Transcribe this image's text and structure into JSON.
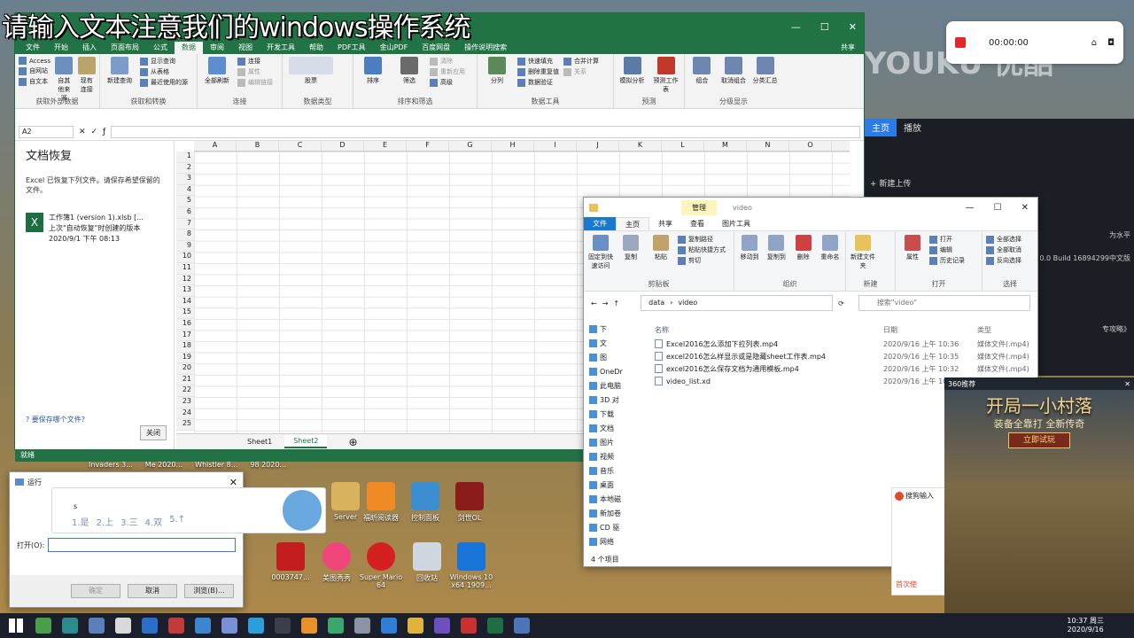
{
  "overlay": {
    "title": "请输入文本注意我们的windows操作系统"
  },
  "excel": {
    "tabs": [
      "文件",
      "开始",
      "插入",
      "页面布局",
      "公式",
      "数据",
      "审阅",
      "视图",
      "开发工具",
      "帮助",
      "PDF工具",
      "金山PDF",
      "百度网盘"
    ],
    "active_tab": "数据",
    "tell_me": "操作说明搜索",
    "share": "共享",
    "groups": [
      {
        "label": "获取外部数据",
        "buttons": [
          "Access",
          "自网站",
          "自文本",
          "自其他来源",
          "现有连接"
        ]
      },
      {
        "label": "获取和转换",
        "buttons": [
          "新建查询",
          "显示查询",
          "从表格",
          "最近使用的源"
        ]
      },
      {
        "label": "连接",
        "buttons": [
          "全部刷新",
          "连接",
          "属性",
          "编辑链接"
        ]
      },
      {
        "label": "数据类型",
        "buttons": [
          "股票"
        ]
      },
      {
        "label": "排序和筛选",
        "buttons": [
          "排序",
          "筛选",
          "清除",
          "重新应用",
          "高级"
        ]
      },
      {
        "label": "数据工具",
        "buttons": [
          "分列",
          "快速填充",
          "删除重复值",
          "数据验证",
          "合并计算",
          "关系"
        ]
      },
      {
        "label": "预测",
        "buttons": [
          "模拟分析",
          "预测工作表"
        ]
      },
      {
        "label": "分级显示",
        "buttons": [
          "组合",
          "取消组合",
          "分类汇总"
        ]
      }
    ],
    "name_box": "A2",
    "recovery": {
      "title": "文档恢复",
      "desc": "Excel 已恢复下列文件。请保存希望保留的文件。",
      "file_name": "工作簿1 (version 1).xlsb [...",
      "file_desc": "上次\"自动恢复\"时创建的版本",
      "file_time": "2020/9/1 下午 08:13",
      "question": "要保存哪个文件?",
      "close": "关闭"
    },
    "columns": [
      "A",
      "B",
      "C",
      "D",
      "E",
      "F",
      "G",
      "H",
      "I",
      "J",
      "K",
      "L",
      "M",
      "N",
      "O"
    ],
    "rows": [
      "1",
      "2",
      "3",
      "4",
      "5",
      "6",
      "7",
      "8",
      "9",
      "10",
      "11",
      "12",
      "13",
      "14",
      "15",
      "16",
      "17",
      "18",
      "19",
      "20",
      "21",
      "22",
      "23",
      "24",
      "25"
    ],
    "sheets": [
      "Sheet1",
      "Sheet2"
    ],
    "active_sheet": "Sheet2",
    "status": "就绪"
  },
  "explorer": {
    "manage": "管理",
    "folder_title": "video",
    "tabs": [
      "文件",
      "主页",
      "共享",
      "查看",
      "图片工具"
    ],
    "groups": [
      {
        "label": "剪贴板",
        "buttons": [
          "固定到快速访问",
          "复制",
          "粘贴",
          "复制路径",
          "粘贴快捷方式",
          "剪切"
        ]
      },
      {
        "label": "组织",
        "buttons": [
          "移动到",
          "复制到",
          "删除",
          "重命名"
        ]
      },
      {
        "label": "新建",
        "buttons": [
          "新建文件夹"
        ]
      },
      {
        "label": "打开",
        "buttons": [
          "属性",
          "打开",
          "编辑",
          "历史记录"
        ]
      },
      {
        "label": "选择",
        "buttons": [
          "全部选择",
          "全部取消",
          "反向选择"
        ]
      }
    ],
    "path": [
      "data",
      "video"
    ],
    "search_placeholder": "搜索\"video\"",
    "headers": [
      "名称",
      "日期",
      "类型"
    ],
    "files": [
      {
        "name": "Excel2016怎么添加下拉列表.mp4",
        "date": "2020/9/16 上午 10:36",
        "type": "媒体文件(.mp4)"
      },
      {
        "name": "excel2016怎么样显示或是隐藏sheet工作表.mp4",
        "date": "2020/9/16 上午 10:35",
        "type": "媒体文件(.mp4)"
      },
      {
        "name": "excel2016怎么保存文档为通用模板.mp4",
        "date": "2020/9/16 上午 10:32",
        "type": "媒体文件(.mp4)"
      },
      {
        "name": "video_list.xd",
        "date": "2020/9/16 上午 10:..",
        "type": ""
      }
    ],
    "nav": [
      "下",
      "文",
      "图",
      "OneDr",
      "此电脑",
      "3D 对",
      "下载",
      "文档",
      "图片",
      "视频",
      "音乐",
      "桌面",
      "本地磁",
      "新加卷",
      "CD 驱",
      "网络"
    ],
    "count": "4 个项目"
  },
  "recorder": {
    "time": "00:00:00"
  },
  "youku": {
    "tabs": [
      "主页",
      "播放"
    ],
    "new_upload": "+ 新建上传",
    "side_texts": [
      "为水平",
      "0.0 Build 16894299中文版",
      "专攻略》"
    ]
  },
  "ad": {
    "header": "360推荐",
    "title": "开局一小村落",
    "sub": "装备全靠打 全新传奇",
    "cta": "立即试玩"
  },
  "run": {
    "title": "运行",
    "open_label": "打开(O):",
    "ok": "确定",
    "cancel": "取消",
    "browse": "浏览(B)..."
  },
  "ime": {
    "code": "s",
    "candidates": [
      "1.是",
      "2.上",
      "3.三",
      "4.双",
      "5.↑"
    ]
  },
  "sogou": {
    "title": "搜狗输入",
    "footer": "首次使"
  },
  "desktop": {
    "icons": [
      "Invaders 3...",
      "Me 2020...",
      "Whistler 8...",
      "98 2020...",
      "Server",
      "福昕阅读器",
      "控制面板",
      "剑世OL",
      "0003747...",
      "美图秀秀",
      "Super Mario 64",
      "回收站",
      "Windows 10 x64 1909..."
    ]
  },
  "taskbar": {
    "time": "10:37 周三",
    "date": "2020/9/16"
  }
}
